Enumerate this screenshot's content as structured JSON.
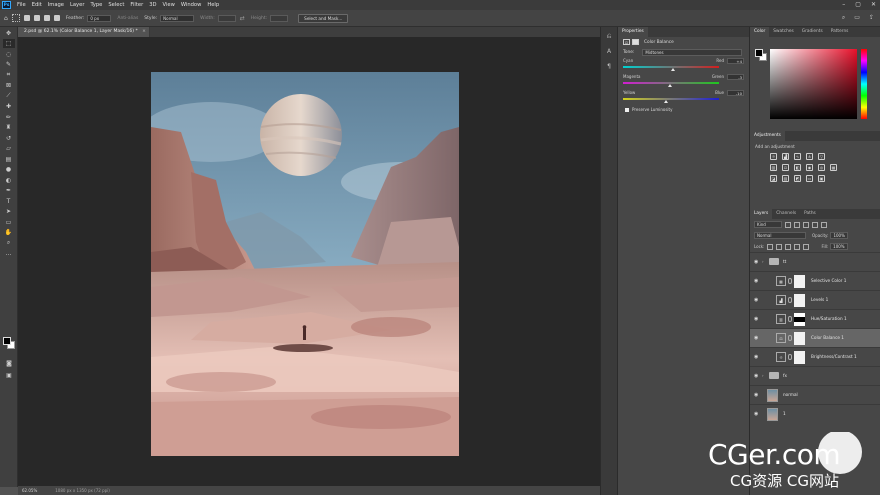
{
  "menu": {
    "logo": "Ps",
    "items": [
      "File",
      "Edit",
      "Image",
      "Layer",
      "Type",
      "Select",
      "Filter",
      "3D",
      "View",
      "Window",
      "Help"
    ],
    "window_controls": [
      "–",
      "▢",
      "✕"
    ]
  },
  "options": {
    "feather_label": "Feather:",
    "feather_value": "0 px",
    "antialias_label": "Anti-alias",
    "style_label": "Style:",
    "style_value": "Normal",
    "width_label": "Width:",
    "height_label": "Height:",
    "select_mask_button": "Select and Mask..."
  },
  "document": {
    "tab_title": "2.psd @ 62.1% (Color Balance 1, Layer Mask/16) *",
    "zoom": "62.05%",
    "doc_size": "1080 px x 1350 px (72 ppi)"
  },
  "properties": {
    "tabs": [
      "Properties"
    ],
    "adjustment_name": "Color Balance",
    "tone_label": "Tone:",
    "tone_value": "Midtones",
    "sliders": [
      {
        "left": "Cyan",
        "right": "Red",
        "value": "+4",
        "position": 0.52,
        "gradient": [
          "#00d2d2",
          "#d21e1e"
        ]
      },
      {
        "left": "Magenta",
        "right": "Green",
        "value": "-3",
        "position": 0.485,
        "gradient": [
          "#d21ed2",
          "#1ec81e"
        ]
      },
      {
        "left": "Yellow",
        "right": "Blue",
        "value": "-10",
        "position": 0.45,
        "gradient": [
          "#d2d21e",
          "#1e1ed2"
        ]
      }
    ],
    "preserve_luminosity": "Preserve Luminosity"
  },
  "color_panel": {
    "tabs": [
      "Color",
      "Swatches",
      "Gradients",
      "Patterns"
    ],
    "hue": "#e8102a"
  },
  "adjustments": {
    "tab": "Adjustments",
    "hint": "Add an adjustment"
  },
  "layers": {
    "tabs": [
      "Layers",
      "Channels",
      "Paths"
    ],
    "kind": "Kind",
    "blend_mode": "Normal",
    "opacity_label": "Opacity:",
    "opacity_value": "100%",
    "lock_label": "Lock:",
    "fill_label": "Fill:",
    "fill_value": "100%",
    "items": [
      {
        "kind": "group",
        "name": "tt"
      },
      {
        "kind": "adjustment",
        "name": "Selective Color 1",
        "icon": "▦",
        "mask": "white"
      },
      {
        "kind": "adjustment",
        "name": "Levels 1",
        "icon": "▟",
        "mask": "white"
      },
      {
        "kind": "adjustment",
        "name": "Hue/Saturation 1",
        "icon": "▥",
        "mask": "black"
      },
      {
        "kind": "adjustment",
        "name": "Color Balance 1",
        "icon": "⚖",
        "mask": "white",
        "selected": true
      },
      {
        "kind": "adjustment",
        "name": "Brightness/Contrast 1",
        "icon": "☼",
        "mask": "white"
      },
      {
        "kind": "group",
        "name": "fx"
      },
      {
        "kind": "image",
        "name": "normal"
      },
      {
        "kind": "image",
        "name": "1"
      }
    ]
  },
  "watermark": {
    "title": "CGer.com",
    "subtitle": "CG资源 CG网站"
  }
}
